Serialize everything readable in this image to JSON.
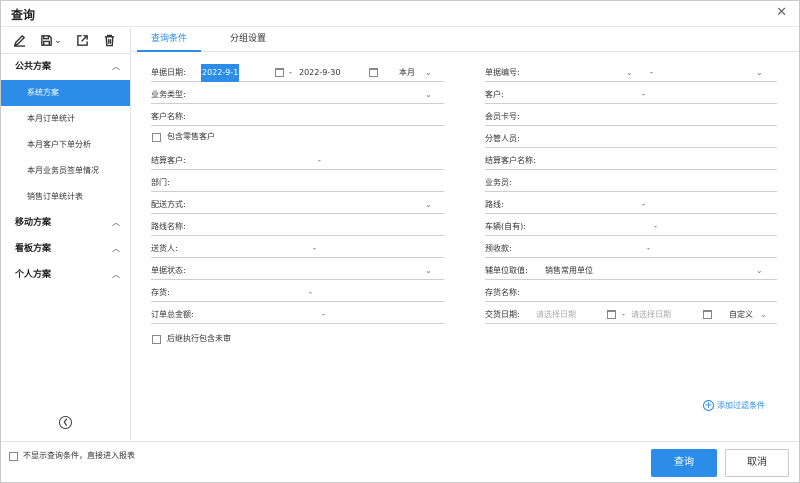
{
  "window": {
    "title": "查询"
  },
  "sidebar": {
    "public_group": "公共方案",
    "items": [
      "系统方案",
      "本月订单统计",
      "本月客户下单分析",
      "本月业务员签单情况",
      "销售订单统计表"
    ],
    "groups": [
      "移动方案",
      "看板方案",
      "个人方案"
    ]
  },
  "tabs": [
    "查询条件",
    "分组设置"
  ],
  "left_fields": {
    "date_label": "单据日期:",
    "date_from": "2022-9-1",
    "date_to": "2022-9-30",
    "date_period": "本月",
    "business_type": "业务类型:",
    "customer_name": "客户名称:",
    "include_retail": "包含零售客户",
    "settle_customer": "结算客户:",
    "department": "部门:",
    "delivery_method": "配送方式:",
    "route_name": "路线名称:",
    "delivery_person": "送货人:",
    "doc_status": "单据状态:",
    "inventory": "存货:",
    "order_total": "订单总金额:",
    "post_exec": "后继执行包含未审"
  },
  "right_fields": {
    "doc_no": "单据编号:",
    "customer": "客户:",
    "member_card": "会员卡号:",
    "manager": "分管人员:",
    "settle_customer_name": "结算客户名称:",
    "salesman": "业务员:",
    "route": "路线:",
    "vehicle": "车辆(自有):",
    "prepay": "预收款:",
    "aux_unit": "辅单位取值:",
    "aux_unit_value": "销售常用单位",
    "inventory_name": "存货名称:",
    "delivery_date": "交货日期:",
    "delivery_date_ph": "请选择日期",
    "delivery_date_mode": "自定义"
  },
  "add_filter": "添加过滤条件",
  "footer": {
    "skip_label": "不显示查询条件，直接进入报表",
    "query": "查询",
    "cancel": "取消"
  }
}
